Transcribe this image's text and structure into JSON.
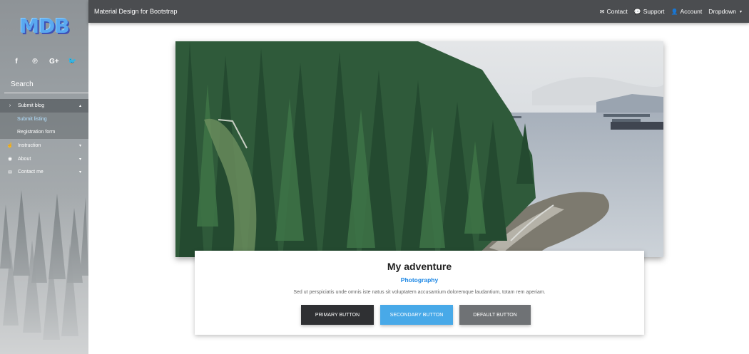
{
  "sidebar": {
    "logo_text": "MDB",
    "social": [
      {
        "icon": "facebook-icon",
        "glyph": "f"
      },
      {
        "icon": "pinterest-icon",
        "glyph": "℗"
      },
      {
        "icon": "google-plus-icon",
        "glyph": "G+"
      },
      {
        "icon": "twitter-icon",
        "glyph": "🐦"
      }
    ],
    "search_placeholder": "Search",
    "menu": [
      {
        "label": "Submit blog",
        "icon": "chevron-right-icon",
        "glyph": "›",
        "expanded": true,
        "children": [
          "Submit listing",
          "Registration form"
        ]
      },
      {
        "label": "Instruction",
        "icon": "hand-pointer-icon",
        "glyph": "☝"
      },
      {
        "label": "About",
        "icon": "eye-icon",
        "glyph": "◉"
      },
      {
        "label": "Contact me",
        "icon": "envelope-icon",
        "glyph": "✉"
      }
    ]
  },
  "navbar": {
    "brand": "Material Design for Bootstrap",
    "links": [
      {
        "label": "Contact",
        "icon": "envelope-icon",
        "glyph": "✉"
      },
      {
        "label": "Support",
        "icon": "comments-icon",
        "glyph": "💬"
      },
      {
        "label": "Account",
        "icon": "user-icon",
        "glyph": "👤"
      },
      {
        "label": "Dropdown",
        "icon": "caret-down-icon",
        "glyph": "▾"
      }
    ]
  },
  "card": {
    "title": "My adventure",
    "subtitle": "Photography",
    "text": "Sed ut perspiciatis unde omnis iste natus sit voluptatem accusantium doloremque laudantium, totam rem aperiam.",
    "buttons": {
      "primary": "Primary button",
      "secondary": "Secondary button",
      "default": "Default button"
    }
  },
  "colors": {
    "navbar": "#4b4d50",
    "accent_blue": "#1e88e5",
    "primary_button": "#2f3033",
    "secondary_button": "#48a9e8",
    "default_button": "#6f7275"
  }
}
